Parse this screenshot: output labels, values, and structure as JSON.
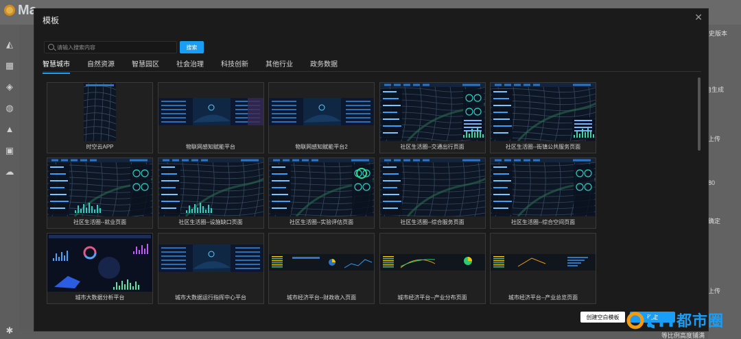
{
  "background": {
    "brand": "Ma",
    "right_items": [
      "历史版本",
      "自生成",
      "上传",
      "80",
      "确定",
      "上传"
    ],
    "bottom_hint": "等比例高度铺满"
  },
  "modal": {
    "title": "模板",
    "search": {
      "placeholder": "请输入搜索内容",
      "value": "",
      "button": "搜索"
    },
    "tabs": [
      {
        "label": "智慧城市",
        "active": true
      },
      {
        "label": "自然资源",
        "active": false
      },
      {
        "label": "智慧园区",
        "active": false
      },
      {
        "label": "社会治理",
        "active": false
      },
      {
        "label": "科技创新",
        "active": false
      },
      {
        "label": "其他行业",
        "active": false
      },
      {
        "label": "政务数据",
        "active": false
      }
    ],
    "templates": [
      {
        "label": "时空云APP",
        "style": "mobile"
      },
      {
        "label": "物联网感知赋能平台",
        "style": "wide-a"
      },
      {
        "label": "物联网感知赋能平台2",
        "style": "wide-b"
      },
      {
        "label": "社区生活圈--交通出行页面",
        "style": "map-a"
      },
      {
        "label": "社区生活圈--街镇公共服务页面",
        "style": "map-b"
      },
      {
        "label": "社区生活圈--就业页面",
        "style": "map-c"
      },
      {
        "label": "社区生活圈--设施缺口页面",
        "style": "map-d"
      },
      {
        "label": "社区生活圈--实验评估页面",
        "style": "map-e"
      },
      {
        "label": "社区生活圈--综合服务页面",
        "style": "map-f"
      },
      {
        "label": "社区生活圈--综合空间页面",
        "style": "map-g"
      },
      {
        "label": "城市大数据分析平台",
        "style": "charts-a"
      },
      {
        "label": "城市大数据运行指挥中心平台",
        "style": "wide-c"
      },
      {
        "label": "城市经济平台--财政收入页面",
        "style": "dark-a"
      },
      {
        "label": "城市经济平台--产业分布页面",
        "style": "dark-b"
      },
      {
        "label": "城市经济平台--产业总览页面",
        "style": "dark-c"
      }
    ],
    "create_button": "创建空白模板",
    "confirm_button": "确定"
  },
  "watermark": {
    "text": "都市圈",
    "logo_text": "O.cn"
  },
  "colors": {
    "accent": "#1a9df5",
    "modal_bg": "#1b1b1b",
    "map_bg": "#0e1726"
  }
}
